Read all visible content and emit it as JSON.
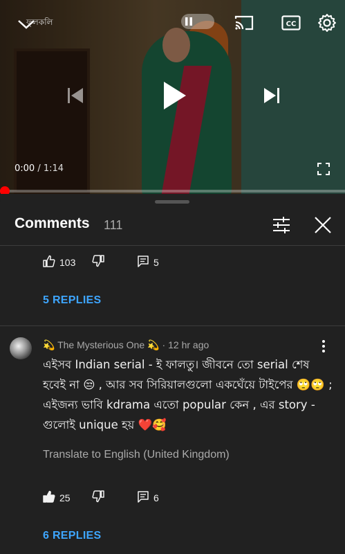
{
  "player": {
    "channel_watermark": "ফুলকলি",
    "current_time": "0:00",
    "separator": " / ",
    "duration": "1:14",
    "progress_fraction": 0.0
  },
  "comments_panel": {
    "title": "Comments",
    "count": "111"
  },
  "previous_comment": {
    "likes": "103",
    "reply_count": "5",
    "replies_label": "5 REPLIES"
  },
  "comment": {
    "author": "💫 The Mysterious One 💫",
    "dot": "·",
    "time": "12 hr ago",
    "text": "এইসব Indian serial - ই ফালতু। জীবনে তো serial শেষ হবেই না 😒 , আর সব সিরিয়ালগুলো একঘেঁয়ে টাইপের 🙄🙄 ; এইজন্য ভাবি kdrama এতো popular কেন , এর story - গুলোই unique হয় ❤️🥰",
    "translate_label": "Translate to English (United Kingdom)",
    "likes": "25",
    "reply_count": "6",
    "replies_label": "6 REPLIES"
  },
  "colors": {
    "background": "#212121",
    "accent_link": "#3ea6ff",
    "progress": "#ff0000"
  },
  "icons": [
    "chevron-down-icon",
    "pause-icon",
    "cast-icon",
    "captions-icon",
    "settings-icon",
    "previous-icon",
    "play-icon",
    "next-icon",
    "fullscreen-icon",
    "filter-icon",
    "close-icon",
    "thumbs-up-icon",
    "thumbs-down-icon",
    "reply-icon",
    "more-vertical-icon"
  ]
}
